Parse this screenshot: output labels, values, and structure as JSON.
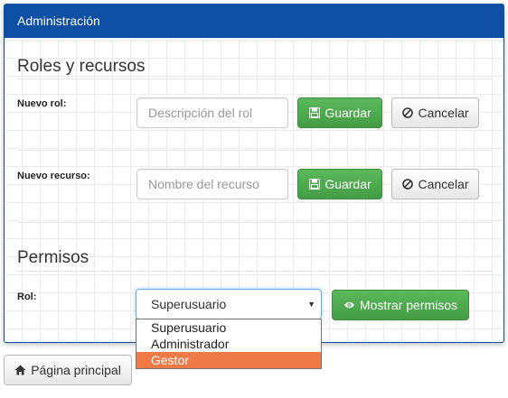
{
  "panel": {
    "heading": "Administración"
  },
  "roles_section": {
    "title": "Roles y recursos",
    "new_role": {
      "label": "Nuevo rol:",
      "placeholder": "Descripción del rol",
      "save_label": "Guardar",
      "cancel_label": "Cancelar"
    },
    "new_resource": {
      "label": "Nuevo recurso:",
      "placeholder": "Nombre del recurso",
      "save_label": "Guardar",
      "cancel_label": "Cancelar"
    }
  },
  "permissions_section": {
    "title": "Permisos",
    "role_label": "Rol:",
    "selected_role": "Superusuario",
    "options": [
      "Superusuario",
      "Administrador",
      "Gestor"
    ],
    "highlighted_option": "Gestor",
    "show_permissions_label": "Mostrar permisos"
  },
  "footer": {
    "home_label": "Página principal"
  },
  "icons": {
    "save": "floppy-disk-icon",
    "cancel": "ban-icon",
    "show": "eye-icon",
    "home": "home-icon",
    "dropdown": "caret-down-icon"
  },
  "colors": {
    "heading_bg": "#0d4fa3",
    "success": "#5cb85c",
    "highlight": "#ef7a45"
  }
}
